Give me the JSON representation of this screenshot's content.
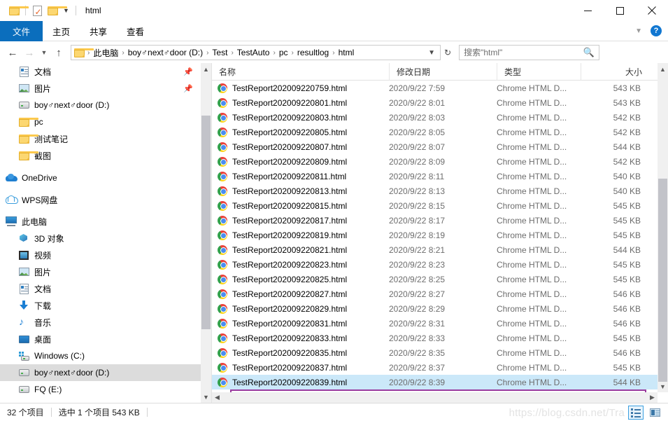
{
  "window": {
    "title": "html",
    "quick_access": [
      "folder-icon",
      "properties-icon",
      "new-folder-icon"
    ],
    "controls": {
      "minimize": "—",
      "maximize": "□",
      "close": "✕"
    }
  },
  "ribbon": {
    "tabs": [
      {
        "label": "文件",
        "active": true
      },
      {
        "label": "主页",
        "active": false
      },
      {
        "label": "共享",
        "active": false
      },
      {
        "label": "查看",
        "active": false
      }
    ],
    "collapse_icon": "chevron-down-icon",
    "help_label": "?"
  },
  "navbar": {
    "back": "←",
    "forward": "→",
    "recent": "⌄",
    "up": "↑",
    "breadcrumbs": [
      "此电脑",
      "boy♂next♂door (D:)",
      "Test",
      "TestAuto",
      "pc",
      "resultlog",
      "html"
    ],
    "separator": "›",
    "dropdown": "⌄",
    "refresh": "↻"
  },
  "search": {
    "placeholder": "搜索\"html\"",
    "value": "",
    "icon": "search-icon"
  },
  "sidebar": {
    "items": [
      {
        "label": "文档",
        "icon": "document-icon",
        "indent": 1,
        "pinned": true,
        "selected": false
      },
      {
        "label": "图片",
        "icon": "pictures-icon",
        "indent": 1,
        "pinned": true,
        "selected": false
      },
      {
        "label": "boy♂next♂door (D:)",
        "icon": "drive-icon",
        "indent": 1,
        "pinned": false,
        "selected": false
      },
      {
        "label": "pc",
        "icon": "folder-icon",
        "indent": 1,
        "pinned": false,
        "selected": false
      },
      {
        "label": "测试笔记",
        "icon": "folder-icon",
        "indent": 1,
        "pinned": false,
        "selected": false
      },
      {
        "label": "截图",
        "icon": "folder-icon",
        "indent": 1,
        "pinned": false,
        "selected": false
      },
      {
        "label": "OneDrive",
        "icon": "onedrive-icon",
        "indent": 0,
        "pinned": false,
        "selected": false
      },
      {
        "label": "WPS网盘",
        "icon": "wps-cloud-icon",
        "indent": 0,
        "pinned": false,
        "selected": false
      },
      {
        "label": "此电脑",
        "icon": "this-pc-icon",
        "indent": 0,
        "pinned": false,
        "selected": false
      },
      {
        "label": "3D 对象",
        "icon": "3d-objects-icon",
        "indent": 1,
        "pinned": false,
        "selected": false
      },
      {
        "label": "视频",
        "icon": "videos-icon",
        "indent": 1,
        "pinned": false,
        "selected": false
      },
      {
        "label": "图片",
        "icon": "pictures-icon",
        "indent": 1,
        "pinned": false,
        "selected": false
      },
      {
        "label": "文档",
        "icon": "document-icon",
        "indent": 1,
        "pinned": false,
        "selected": false
      },
      {
        "label": "下载",
        "icon": "downloads-icon",
        "indent": 1,
        "pinned": false,
        "selected": false
      },
      {
        "label": "音乐",
        "icon": "music-icon",
        "indent": 1,
        "pinned": false,
        "selected": false
      },
      {
        "label": "桌面",
        "icon": "desktop-icon",
        "indent": 1,
        "pinned": false,
        "selected": false
      },
      {
        "label": "Windows (C:)",
        "icon": "windows-drive-icon",
        "indent": 1,
        "pinned": false,
        "selected": false
      },
      {
        "label": "boy♂next♂door (D:)",
        "icon": "drive-icon",
        "indent": 1,
        "pinned": false,
        "selected": true
      },
      {
        "label": "FQ (E:)",
        "icon": "drive-icon",
        "indent": 1,
        "pinned": false,
        "selected": false
      }
    ],
    "scroll_up": "⌃",
    "scroll_down": "⌄"
  },
  "filelist": {
    "columns": [
      {
        "label": "名称",
        "key": "name",
        "sorted": "asc"
      },
      {
        "label": "修改日期",
        "key": "date"
      },
      {
        "label": "类型",
        "key": "type"
      },
      {
        "label": "大小",
        "key": "size"
      }
    ],
    "sort_caret": "⌃",
    "rows": [
      {
        "name": "TestReport202009220759.html",
        "date": "2020/9/22 7:59",
        "type": "Chrome HTML D...",
        "size": "543 KB",
        "icon": "chrome-icon",
        "selected": false
      },
      {
        "name": "TestReport202009220801.html",
        "date": "2020/9/22 8:01",
        "type": "Chrome HTML D...",
        "size": "543 KB",
        "icon": "chrome-icon",
        "selected": false
      },
      {
        "name": "TestReport202009220803.html",
        "date": "2020/9/22 8:03",
        "type": "Chrome HTML D...",
        "size": "542 KB",
        "icon": "chrome-icon",
        "selected": false
      },
      {
        "name": "TestReport202009220805.html",
        "date": "2020/9/22 8:05",
        "type": "Chrome HTML D...",
        "size": "542 KB",
        "icon": "chrome-icon",
        "selected": false
      },
      {
        "name": "TestReport202009220807.html",
        "date": "2020/9/22 8:07",
        "type": "Chrome HTML D...",
        "size": "544 KB",
        "icon": "chrome-icon",
        "selected": false
      },
      {
        "name": "TestReport202009220809.html",
        "date": "2020/9/22 8:09",
        "type": "Chrome HTML D...",
        "size": "542 KB",
        "icon": "chrome-icon",
        "selected": false
      },
      {
        "name": "TestReport202009220811.html",
        "date": "2020/9/22 8:11",
        "type": "Chrome HTML D...",
        "size": "540 KB",
        "icon": "chrome-icon",
        "selected": false
      },
      {
        "name": "TestReport202009220813.html",
        "date": "2020/9/22 8:13",
        "type": "Chrome HTML D...",
        "size": "540 KB",
        "icon": "chrome-icon",
        "selected": false
      },
      {
        "name": "TestReport202009220815.html",
        "date": "2020/9/22 8:15",
        "type": "Chrome HTML D...",
        "size": "545 KB",
        "icon": "chrome-icon",
        "selected": false
      },
      {
        "name": "TestReport202009220817.html",
        "date": "2020/9/22 8:17",
        "type": "Chrome HTML D...",
        "size": "545 KB",
        "icon": "chrome-icon",
        "selected": false
      },
      {
        "name": "TestReport202009220819.html",
        "date": "2020/9/22 8:19",
        "type": "Chrome HTML D...",
        "size": "545 KB",
        "icon": "chrome-icon",
        "selected": false
      },
      {
        "name": "TestReport202009220821.html",
        "date": "2020/9/22 8:21",
        "type": "Chrome HTML D...",
        "size": "544 KB",
        "icon": "chrome-icon",
        "selected": false
      },
      {
        "name": "TestReport202009220823.html",
        "date": "2020/9/22 8:23",
        "type": "Chrome HTML D...",
        "size": "545 KB",
        "icon": "chrome-icon",
        "selected": false
      },
      {
        "name": "TestReport202009220825.html",
        "date": "2020/9/22 8:25",
        "type": "Chrome HTML D...",
        "size": "545 KB",
        "icon": "chrome-icon",
        "selected": false
      },
      {
        "name": "TestReport202009220827.html",
        "date": "2020/9/22 8:27",
        "type": "Chrome HTML D...",
        "size": "546 KB",
        "icon": "chrome-icon",
        "selected": false
      },
      {
        "name": "TestReport202009220829.html",
        "date": "2020/9/22 8:29",
        "type": "Chrome HTML D...",
        "size": "546 KB",
        "icon": "chrome-icon",
        "selected": false
      },
      {
        "name": "TestReport202009220831.html",
        "date": "2020/9/22 8:31",
        "type": "Chrome HTML D...",
        "size": "546 KB",
        "icon": "chrome-icon",
        "selected": false
      },
      {
        "name": "TestReport202009220833.html",
        "date": "2020/9/22 8:33",
        "type": "Chrome HTML D...",
        "size": "545 KB",
        "icon": "chrome-icon",
        "selected": false
      },
      {
        "name": "TestReport202009220835.html",
        "date": "2020/9/22 8:35",
        "type": "Chrome HTML D...",
        "size": "546 KB",
        "icon": "chrome-icon",
        "selected": false
      },
      {
        "name": "TestReport202009220837.html",
        "date": "2020/9/22 8:37",
        "type": "Chrome HTML D...",
        "size": "545 KB",
        "icon": "chrome-icon",
        "selected": false
      },
      {
        "name": "TestReport202009220839.html",
        "date": "2020/9/22 8:39",
        "type": "Chrome HTML D...",
        "size": "544 KB",
        "icon": "chrome-icon",
        "selected": true
      }
    ]
  },
  "statusbar": {
    "item_count": "32 个项目",
    "selection": "选中 1 个项目  543 KB",
    "watermark": "https://blog.csdn.net/Tra",
    "views": [
      {
        "name": "details-view",
        "active": true
      },
      {
        "name": "tiles-view",
        "active": false
      }
    ]
  },
  "colors": {
    "accent": "#0b6ebd",
    "selection_fill": "#cbe8f9",
    "annotation_border": "#9a3b9e",
    "sidebar_selected": "#dcdcdc"
  }
}
